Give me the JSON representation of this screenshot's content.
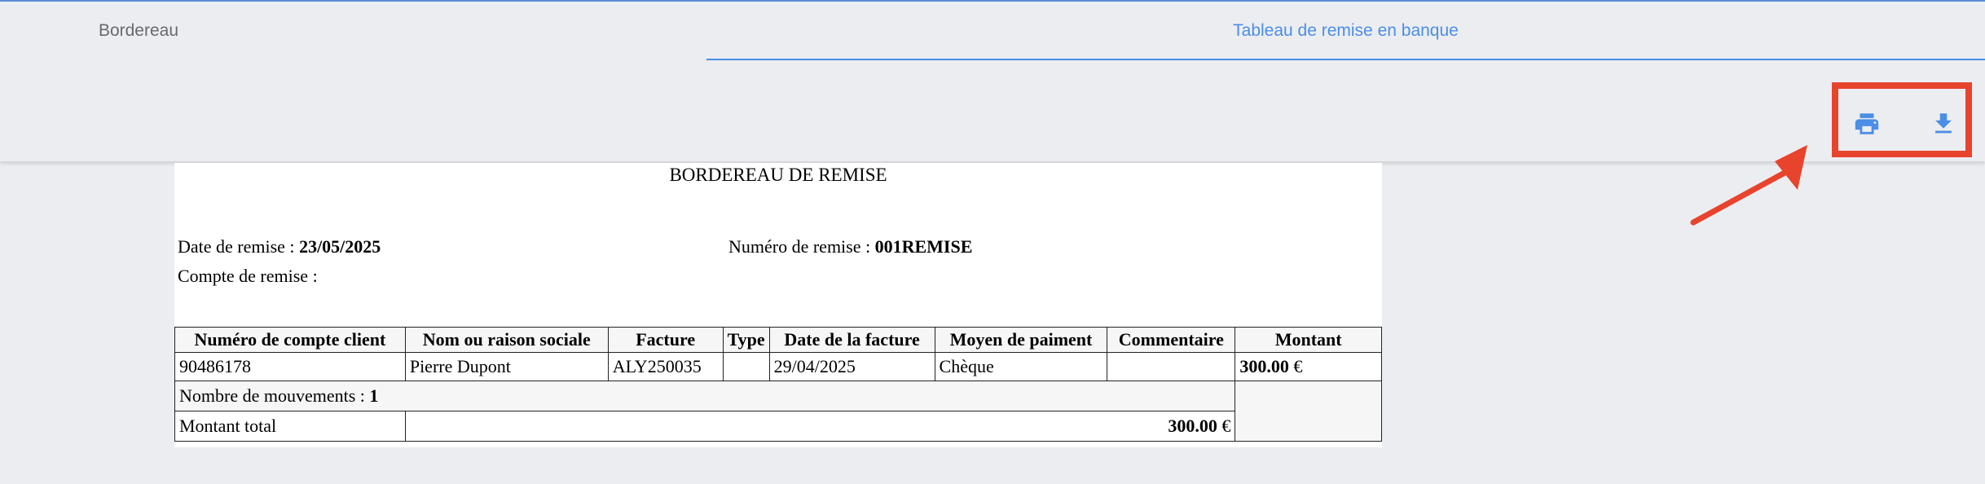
{
  "tabs": [
    {
      "label": "Bordereau"
    },
    {
      "label": "Tableau de remise en banque"
    }
  ],
  "toolbar": {
    "print_icon": "printer-icon",
    "download_icon": "download-icon"
  },
  "document": {
    "title": "BORDEREAU DE REMISE",
    "date_label": "Date de remise : ",
    "date_value": "23/05/2025",
    "numero_label": "Numéro de remise : ",
    "numero_value": "001REMISE",
    "compte_label": "Compte de remise :"
  },
  "table": {
    "headers": [
      "Numéro de compte client",
      "Nom ou raison sociale",
      "Facture",
      "Type",
      "Date de la facture",
      "Moyen de paiment",
      "Commentaire",
      "Montant"
    ],
    "rows": [
      {
        "compte": "90486178",
        "nom": "Pierre Dupont",
        "facture": "ALY250035",
        "type": "",
        "date": "29/04/2025",
        "moyen": "Chèque",
        "commentaire": "",
        "montant": "300.00",
        "devise": " €"
      }
    ],
    "mouvements_label": "Nombre de mouvements : ",
    "mouvements_value": "1",
    "total_label": "Montant total",
    "total_value": "300.00",
    "total_devise": " €"
  },
  "colors": {
    "accent": "#4a8ee6",
    "highlight": "#e8432c"
  }
}
